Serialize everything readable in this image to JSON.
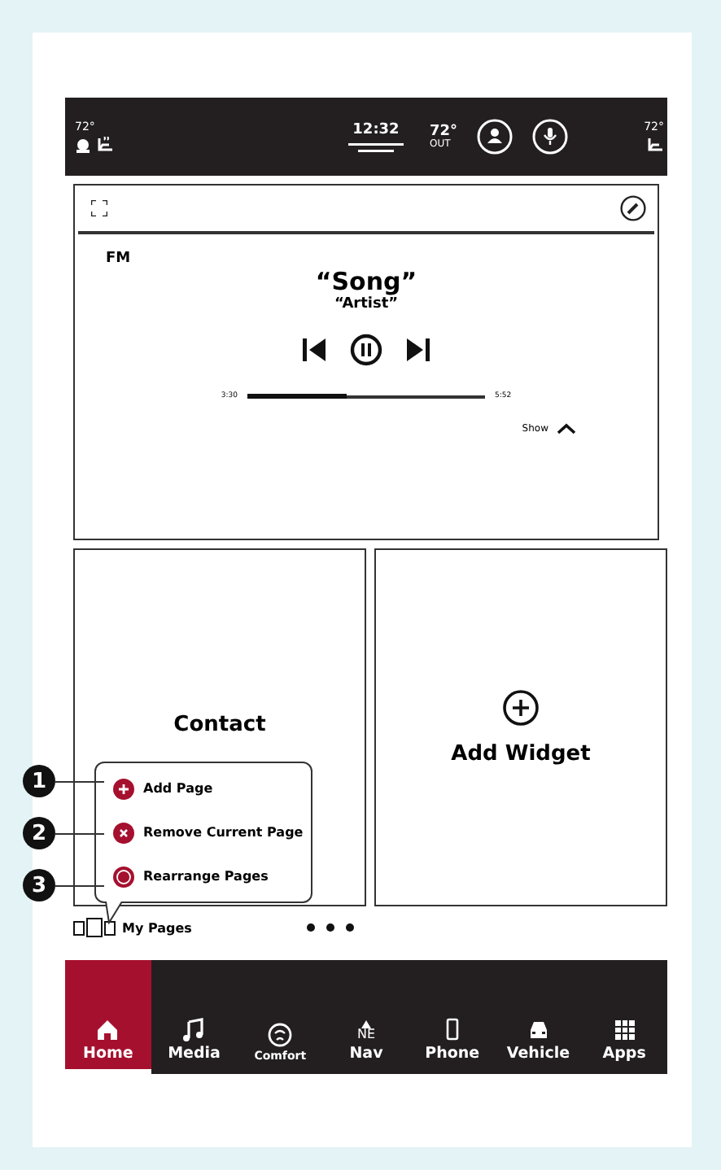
{
  "status_bar": {
    "left_temp": "72°",
    "clock": "12:32",
    "outside_temp": "72°",
    "outside_label": "OUT",
    "right_temp": "72°"
  },
  "media": {
    "source": "FM",
    "song": "“Song”",
    "artist": "“Artist”",
    "elapsed": "3:30",
    "total": "5:52",
    "level": 0.42,
    "show_label": "Show"
  },
  "widgets": [
    {
      "kind": "contact",
      "label": "Contact"
    },
    {
      "kind": "add",
      "label": "Add Widget"
    }
  ],
  "page_menu": [
    {
      "kind": "add",
      "label": "Add Page",
      "callout": "1"
    },
    {
      "kind": "remove",
      "label": "Remove Current Page",
      "callout": "2"
    },
    {
      "kind": "rearrange",
      "label": "Rearrange Pages",
      "callout": "3"
    }
  ],
  "pages_bar": {
    "label": "My Pages"
  },
  "nav": [
    {
      "kind": "home",
      "label": "Home",
      "selected": true
    },
    {
      "kind": "media",
      "label": "Media",
      "selected": false
    },
    {
      "kind": "comfort",
      "label": "Comfort",
      "selected": false
    },
    {
      "kind": "nav",
      "label": "Nav",
      "compass": "NE",
      "selected": false
    },
    {
      "kind": "phone",
      "label": "Phone",
      "selected": false
    },
    {
      "kind": "vehicle",
      "label": "Vehicle",
      "selected": false
    },
    {
      "kind": "apps",
      "label": "Apps",
      "selected": false
    }
  ]
}
